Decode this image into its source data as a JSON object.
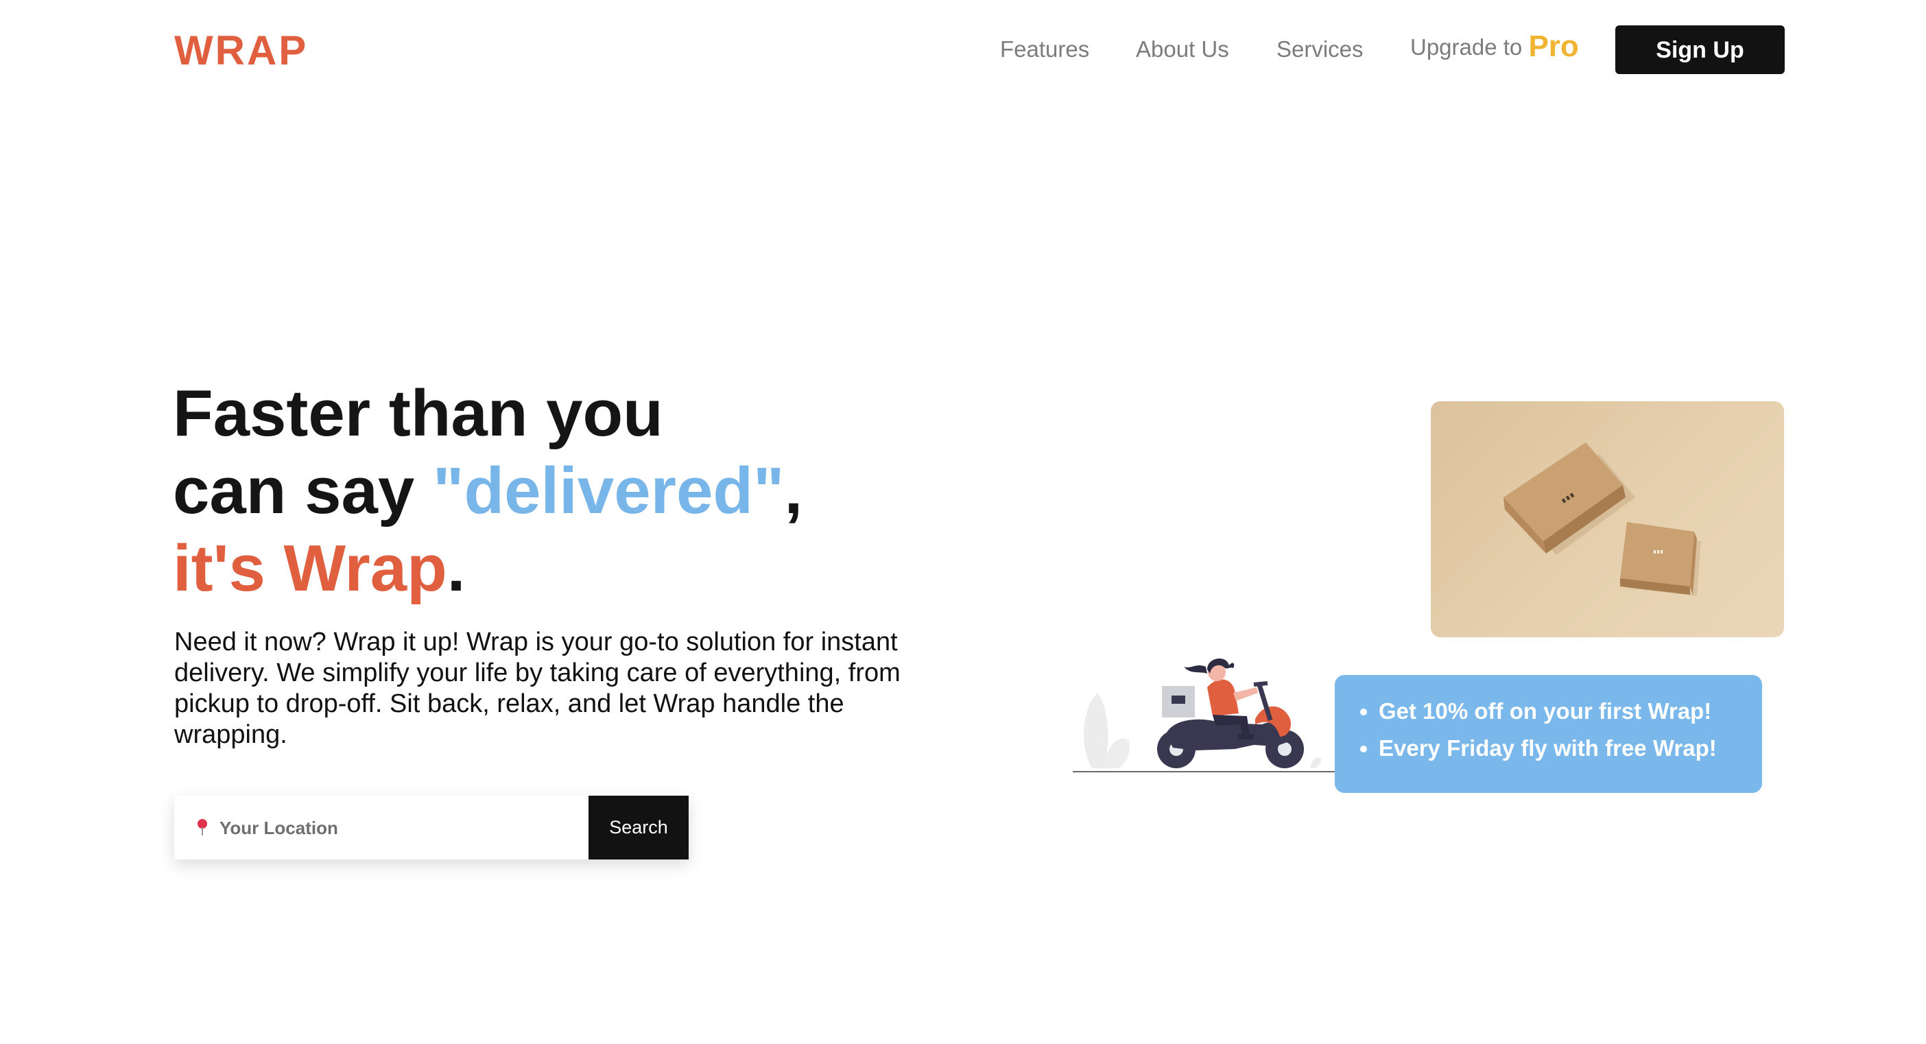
{
  "nav": {
    "logo": "WRAP",
    "links": [
      "Features",
      "About Us",
      "Services"
    ],
    "upgrade_prefix": "Upgrade to",
    "upgrade_highlight": "Pro",
    "signup_label": "Sign Up"
  },
  "hero": {
    "line1": "Faster than you",
    "line2_prefix": "can say ",
    "line2_highlight": "\"delivered\"",
    "line2_suffix": ",",
    "line3_highlight": "it's Wrap",
    "line3_suffix": ".",
    "description": "Need it now? Wrap it up! Wrap is your go-to solution for instant delivery. We simplify your life by taking care of everything, from pickup to drop-off. Sit back, relax, and let Wrap handle the wrapping."
  },
  "search": {
    "placeholder": "Your Location",
    "button_label": "Search",
    "icon": "location-pin-icon"
  },
  "promo": {
    "items": [
      "Get 10% off on your first Wrap!",
      "Every Friday fly with free Wrap!"
    ]
  },
  "colors": {
    "brand_orange": "#e05f3f",
    "accent_blue": "#78b6ea",
    "pro_yellow": "#f0b431",
    "button_dark": "#121212"
  }
}
